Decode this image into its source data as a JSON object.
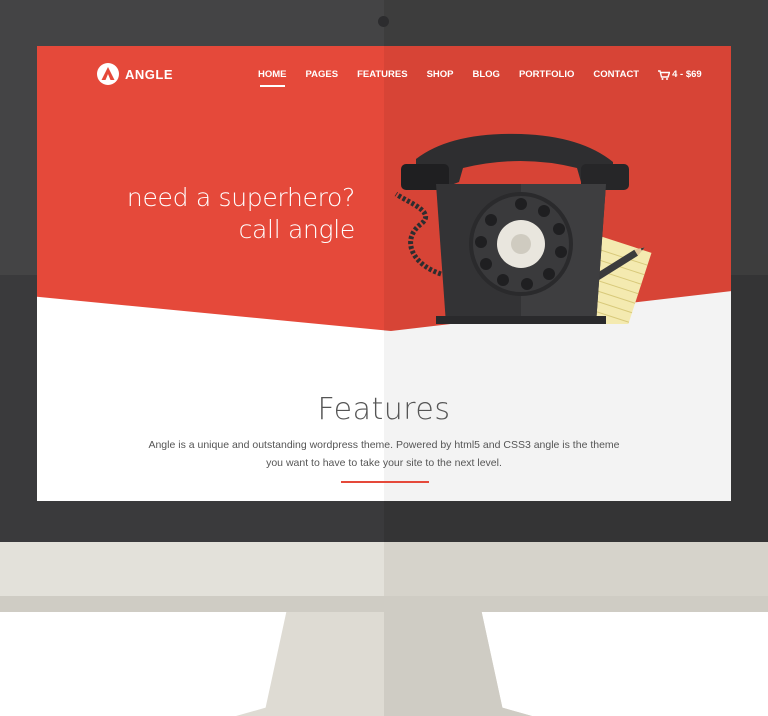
{
  "brand": {
    "name": "ANGLE",
    "accent": "#e5493a"
  },
  "nav": {
    "items": [
      {
        "label": "HOME",
        "active": true
      },
      {
        "label": "PAGES",
        "active": false
      },
      {
        "label": "FEATURES",
        "active": false
      },
      {
        "label": "SHOP",
        "active": false
      },
      {
        "label": "BLOG",
        "active": false
      },
      {
        "label": "PORTFOLIO",
        "active": false
      },
      {
        "label": "CONTACT",
        "active": false
      }
    ],
    "cart": {
      "label": "4 - $69",
      "icon": "shopping-cart-icon"
    }
  },
  "hero": {
    "line1": "need a superhero?",
    "line2": "call angle"
  },
  "features": {
    "title": "Features",
    "line1": "Angle is a unique and outstanding wordpress theme. Powered by html5 and CSS3 angle is the theme",
    "line2": "you want to have to take your site to the next level."
  }
}
